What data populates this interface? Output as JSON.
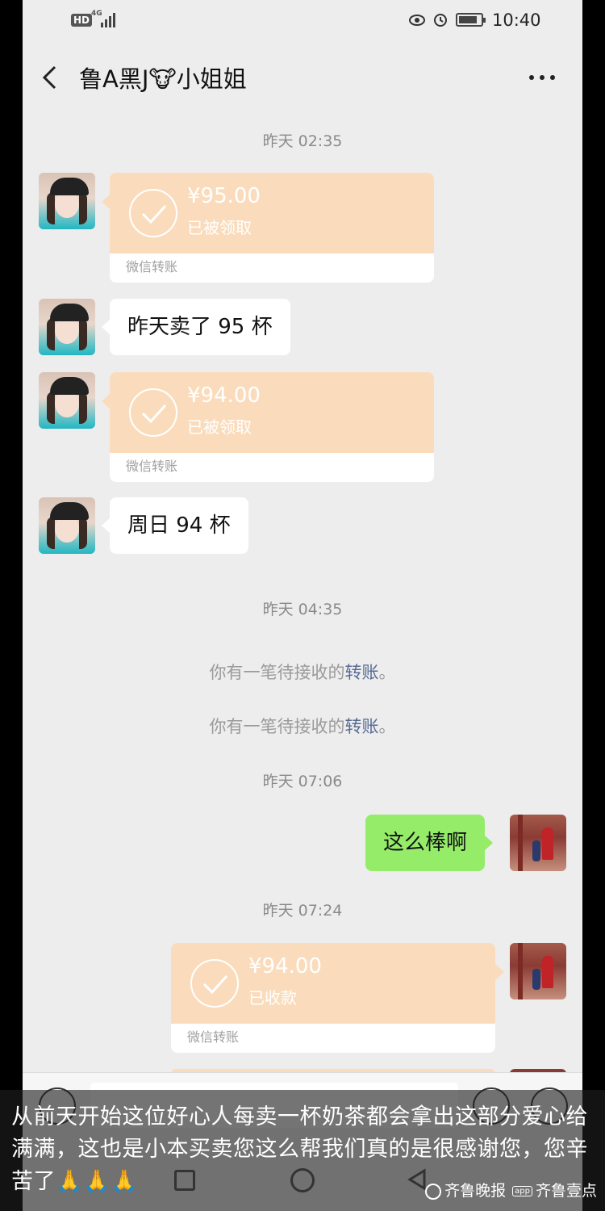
{
  "status_bar": {
    "hd": "HD",
    "network": "4G",
    "time": "10:40",
    "icons": [
      "eye-icon",
      "alarm-icon",
      "battery-icon"
    ]
  },
  "header": {
    "title": "鲁A黑J🐮小姐姐",
    "back_icon": "chevron-left-icon",
    "more_icon": "more-dots-icon"
  },
  "chat": {
    "sep1": "昨天 02:35",
    "t1": {
      "amount": "¥95.00",
      "status": "已被领取",
      "footer": "微信转账"
    },
    "m1": "昨天卖了 95 杯",
    "t2": {
      "amount": "¥94.00",
      "status": "已被领取",
      "footer": "微信转账"
    },
    "m2": "周日 94 杯",
    "sep2": "昨天 04:35",
    "sys1": {
      "prefix": "你有一笔待接收的",
      "link": "转账",
      "suffix": "。"
    },
    "sys2": {
      "prefix": "你有一笔待接收的",
      "link": "转账",
      "suffix": "。"
    },
    "sep3": "昨天 07:06",
    "m3": "这么棒啊",
    "sep4": "昨天 07:24",
    "t3": {
      "amount": "¥94.00",
      "status": "已收款",
      "footer": "微信转账"
    }
  },
  "colors": {
    "chat_bg": "#ededed",
    "transfer_orange": "#fadcbc",
    "self_bubble": "#95ec69",
    "link": "#576b95"
  },
  "caption": {
    "text": "从前天开始这位好心人每卖一杯奶茶都会拿出这部分爱心给满满，这也是小本买卖您这么帮我们真的是很感谢您，您辛苦了",
    "emoji": "🙏🙏🙏",
    "watermark_1": "齐鲁晚报",
    "watermark_2": "齐鲁壹点",
    "watermark_badge": "app"
  }
}
